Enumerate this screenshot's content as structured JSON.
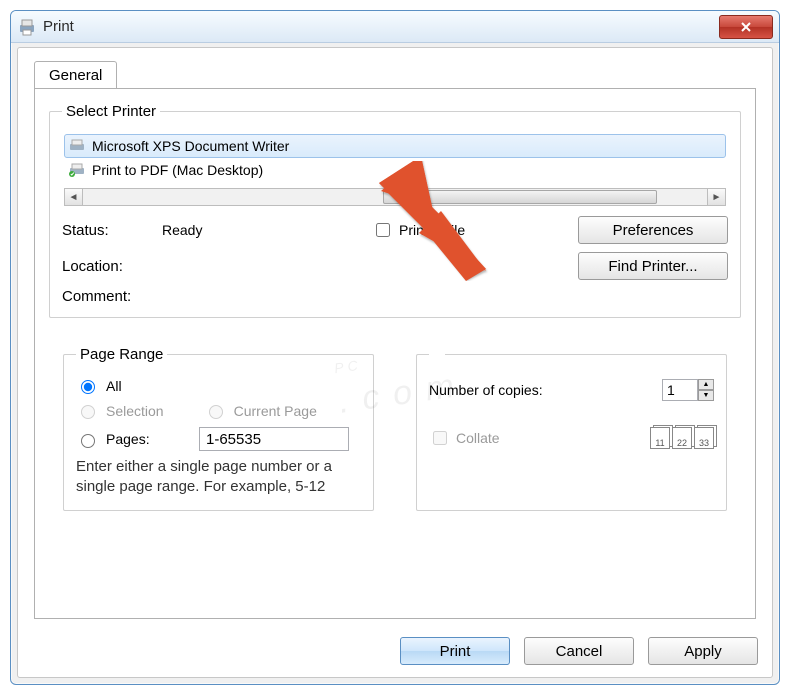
{
  "window": {
    "title": "Print"
  },
  "tabs": {
    "general": "General"
  },
  "printer_group": {
    "legend": "Select Printer",
    "items": [
      {
        "label": "Microsoft XPS Document Writer"
      },
      {
        "label": "Print to PDF (Mac Desktop)"
      }
    ]
  },
  "status": {
    "status_label": "Status:",
    "status_value": "Ready",
    "location_label": "Location:",
    "comment_label": "Comment:",
    "print_to_file": "Print to file",
    "preferences": "Preferences",
    "find_printer": "Find Printer..."
  },
  "page_range": {
    "legend": "Page Range",
    "all": "All",
    "selection": "Selection",
    "current_page": "Current Page",
    "pages": "Pages:",
    "pages_value": "1-65535",
    "hint": "Enter either a single page number or a single page range.  For example, 5-12"
  },
  "copies": {
    "label": "Number of copies:",
    "value": "1",
    "collate": "Collate",
    "collate_pages": [
      "11",
      "22",
      "33"
    ]
  },
  "buttons": {
    "print": "Print",
    "cancel": "Cancel",
    "apply": "Apply"
  },
  "watermark": {
    "main": "PC",
    "sub": ".com"
  }
}
